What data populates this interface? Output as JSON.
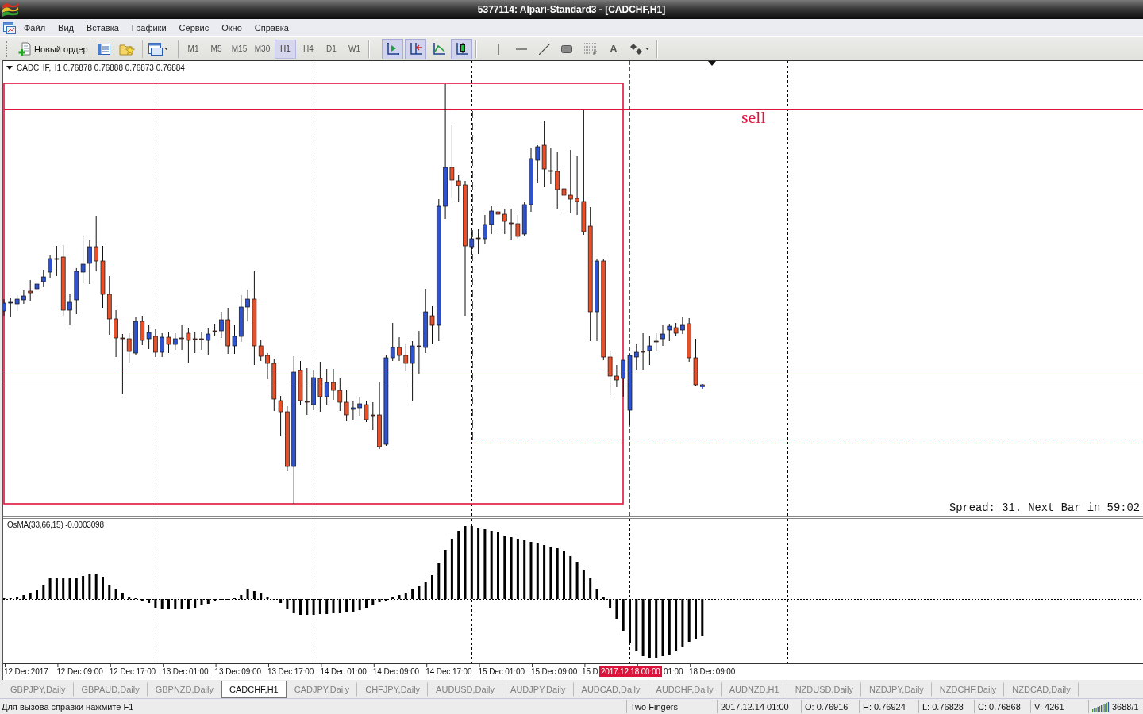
{
  "window": {
    "title": "5377114: Alpari-Standard3 - [CADCHF,H1]"
  },
  "menu": [
    "Файл",
    "Вид",
    "Вставка",
    "Графики",
    "Сервис",
    "Окно",
    "Справка"
  ],
  "toolbar": {
    "new_order": "Новый ордер",
    "timeframes": [
      {
        "label": "M1",
        "selected": false
      },
      {
        "label": "M5",
        "selected": false
      },
      {
        "label": "M15",
        "selected": false
      },
      {
        "label": "M30",
        "selected": false
      },
      {
        "label": "H1",
        "selected": true
      },
      {
        "label": "H4",
        "selected": false
      },
      {
        "label": "D1",
        "selected": false
      },
      {
        "label": "W1",
        "selected": false
      }
    ],
    "chart_buttons": [
      {
        "on": true
      },
      {
        "on": true
      },
      {
        "on": false
      },
      {
        "on": true
      }
    ],
    "text_tool": "A"
  },
  "chart": {
    "info": "CADCHF,H1 0.76878 0.76888 0.76873 0.76884",
    "text_label": "sell",
    "comment": "Spread: 31. Next Bar in 59:02"
  },
  "indicator": {
    "label": "OsMA(33,66,15) -0.0003098"
  },
  "time_axis": {
    "labels": [
      "12 Dec 2017",
      "12 Dec 09:00",
      "12 Dec 17:00",
      "13 Dec 01:00",
      "13 Dec 09:00",
      "13 Dec 17:00",
      "14 Dec 01:00",
      "14 Dec 09:00",
      "14 Dec 17:00",
      "15 Dec 01:00",
      "15 Dec 09:00",
      "15 D",
      "01:00",
      "18 Dec 09:00"
    ],
    "cursor_label": "2017.12.18 00:00"
  },
  "tabs": [
    {
      "label": "GBPJPY,Daily",
      "selected": false
    },
    {
      "label": "GBPAUD,Daily",
      "selected": false
    },
    {
      "label": "GBPNZD,Daily",
      "selected": false
    },
    {
      "label": "CADCHF,H1",
      "selected": true
    },
    {
      "label": "CADJPY,Daily",
      "selected": false
    },
    {
      "label": "CHFJPY,Daily",
      "selected": false
    },
    {
      "label": "AUDUSD,Daily",
      "selected": false
    },
    {
      "label": "AUDJPY,Daily",
      "selected": false
    },
    {
      "label": "AUDCAD,Daily",
      "selected": false
    },
    {
      "label": "AUDCHF,Daily",
      "selected": false
    },
    {
      "label": "AUDNZD,H1",
      "selected": false
    },
    {
      "label": "NZDUSD,Daily",
      "selected": false
    },
    {
      "label": "NZDJPY,Daily",
      "selected": false
    },
    {
      "label": "NZDCHF,Daily",
      "selected": false
    },
    {
      "label": "NZDCAD,Daily",
      "selected": false
    }
  ],
  "status_bar": {
    "help": "Для вызова справки нажмите F1",
    "profile": "Two Fingers",
    "time": "2017.12.14 01:00",
    "open": "O: 0.76916",
    "high": "H: 0.76924",
    "low": "L: 0.76828",
    "close": "C: 0.76868",
    "volume": "V: 4261",
    "traffic": "3688/1"
  }
}
